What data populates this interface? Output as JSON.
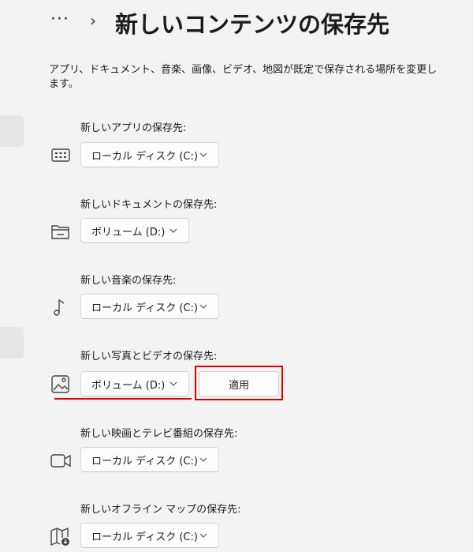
{
  "header": {
    "more_label": "···",
    "chevron": "›",
    "title": "新しいコンテンツの保存先"
  },
  "description": "アプリ、ドキュメント、音楽、画像、ビデオ、地図が既定で保存される場所を変更します。",
  "settings": [
    {
      "label": "新しいアプリの保存先:",
      "value": "ローカル ディスク (C:)",
      "icon": "apps-icon"
    },
    {
      "label": "新しいドキュメントの保存先:",
      "value": "ボリューム (D:)",
      "icon": "folder-icon"
    },
    {
      "label": "新しい音楽の保存先:",
      "value": "ローカル ディスク (C:)",
      "icon": "music-note-icon"
    },
    {
      "label": "新しい写真とビデオの保存先:",
      "value": "ボリューム (D:)",
      "icon": "image-icon"
    },
    {
      "label": "新しい映画とテレビ番組の保存先:",
      "value": "ローカル ディスク (C:)",
      "icon": "video-camera-icon"
    },
    {
      "label": "新しいオフライン マップの保存先:",
      "value": "ローカル ディスク (C:)",
      "icon": "map-download-icon"
    }
  ],
  "apply_label": "適用",
  "colors": {
    "background": "#f3f3f3",
    "highlight": "#e00000"
  }
}
